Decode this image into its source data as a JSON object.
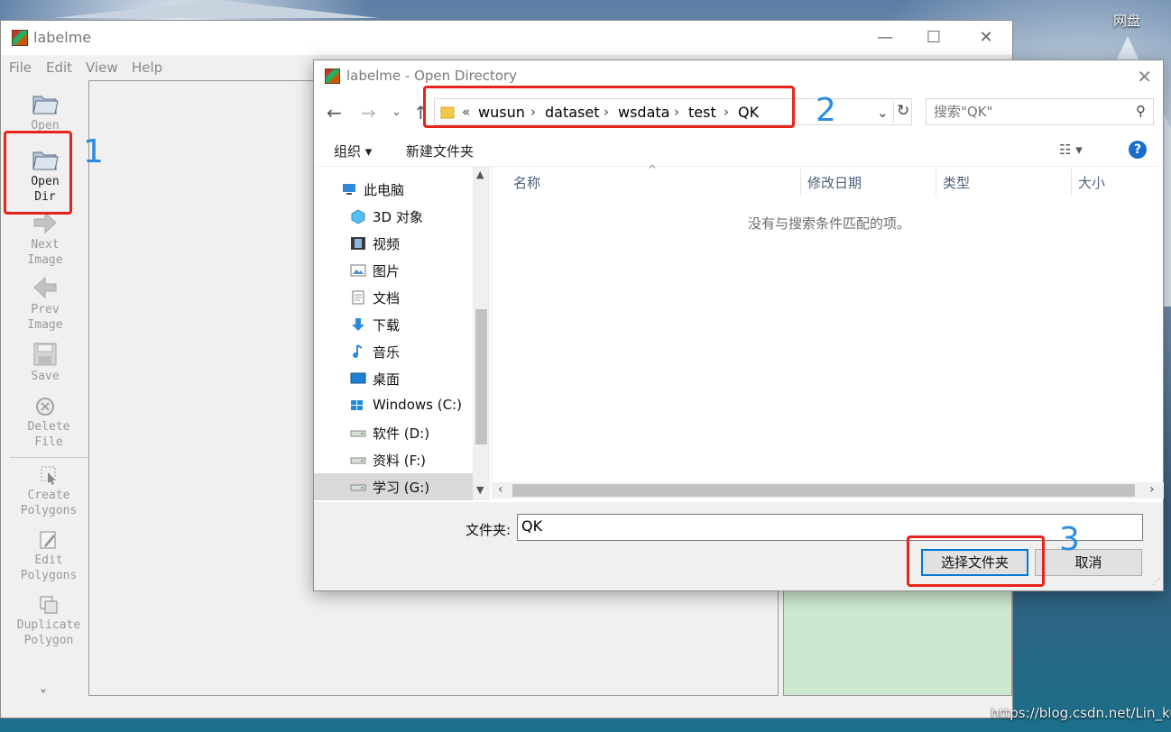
{
  "desktop": {
    "icon_label": "网盘",
    "watermark": "https://blog.csdn.net/Lin_ku"
  },
  "main_window": {
    "title": "labelme",
    "controls": {
      "minimize": "—",
      "maximize": "☐",
      "close": "✕"
    },
    "menu": [
      "File",
      "Edit",
      "View",
      "Help"
    ],
    "tools": [
      {
        "label": "Open",
        "icon": "folder-icon"
      },
      {
        "label": "Open\nDir",
        "icon": "folder-open-icon"
      },
      {
        "label": "Next\nImage",
        "icon": "arrow-right-icon"
      },
      {
        "label": "Prev\nImage",
        "icon": "arrow-left-icon"
      },
      {
        "label": "Save",
        "icon": "save-icon"
      },
      {
        "label": "Delete\nFile",
        "icon": "delete-icon"
      },
      {
        "label": "Create\nPolygons",
        "icon": "create-polygon-icon"
      },
      {
        "label": "Edit\nPolygons",
        "icon": "edit-icon"
      },
      {
        "label": "Duplicate\nPolygon",
        "icon": "duplicate-icon"
      }
    ],
    "more_chevron": "⌄"
  },
  "annotations": {
    "n1": "1",
    "n2": "2",
    "n3": "3"
  },
  "dialog": {
    "title": "labelme - Open Directory",
    "address": {
      "prefix": "«",
      "segments": [
        "wusun",
        "dataset",
        "wsdata",
        "test",
        "QK"
      ]
    },
    "search_placeholder": "搜索\"QK\"",
    "commands": {
      "organize": "组织 ▾",
      "new_folder": "新建文件夹"
    },
    "tree": [
      {
        "label": "此电脑",
        "icon": "computer-icon"
      },
      {
        "label": "3D 对象",
        "icon": "3d-objects-icon"
      },
      {
        "label": "视频",
        "icon": "video-icon"
      },
      {
        "label": "图片",
        "icon": "pictures-icon"
      },
      {
        "label": "文档",
        "icon": "documents-icon"
      },
      {
        "label": "下载",
        "icon": "download-icon"
      },
      {
        "label": "音乐",
        "icon": "music-icon"
      },
      {
        "label": "桌面",
        "icon": "desktop-icon"
      },
      {
        "label": "Windows (C:)",
        "icon": "windows-drive-icon"
      },
      {
        "label": "软件 (D:)",
        "icon": "drive-icon"
      },
      {
        "label": "资料 (F:)",
        "icon": "drive-icon"
      },
      {
        "label": "学习 (G:)",
        "icon": "drive-icon",
        "selected": true
      }
    ],
    "columns": [
      "名称",
      "修改日期",
      "类型",
      "大小"
    ],
    "empty_message": "没有与搜索条件匹配的项。",
    "folder_label": "文件夹:",
    "folder_value": "QK",
    "buttons": {
      "select": "选择文件夹",
      "cancel": "取消"
    }
  },
  "colors": {
    "annotation_red": "#e8231a",
    "annotation_blue": "#2a8de0",
    "accent": "#0078d7"
  }
}
